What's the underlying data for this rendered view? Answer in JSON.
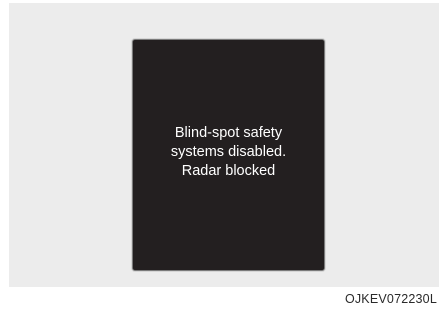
{
  "display": {
    "message_lines": [
      "Blind-spot safety",
      "systems disabled.",
      "Radar blocked"
    ],
    "background_color": "#231f20",
    "text_color": "#ffffff"
  },
  "figure_code": "OJKEV072230L"
}
